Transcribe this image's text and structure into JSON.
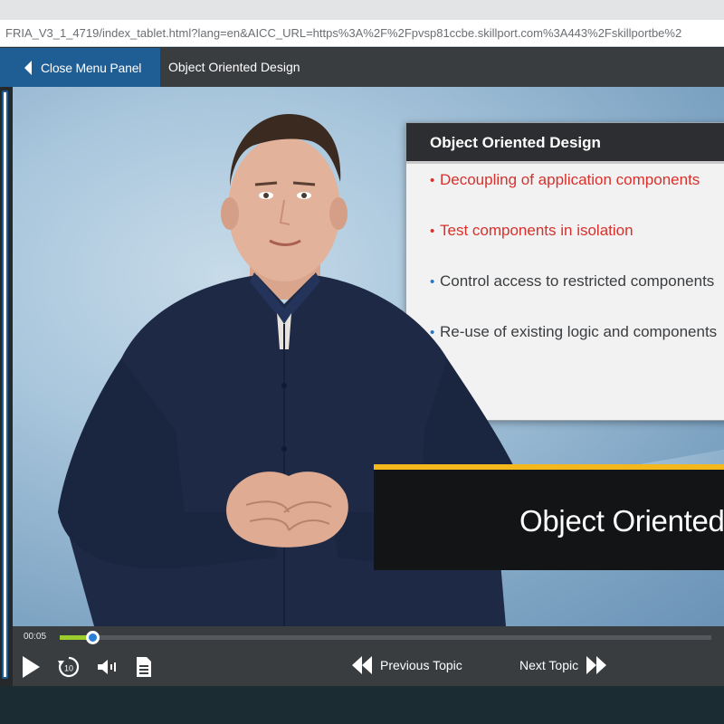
{
  "browser": {
    "url": "FRIA_V3_1_4719/index_tablet.html?lang=en&AICC_URL=https%3A%2F%2Fpvsp81ccbe.skillport.com%3A443%2Fskillportbe%2"
  },
  "header": {
    "close_menu_label": "Close Menu Panel",
    "course_title": "Object Oriented Design"
  },
  "slide": {
    "title": "Object Oriented Design",
    "bullets": [
      {
        "text": "Decoupling of application components",
        "style": "red"
      },
      {
        "text": "Test components in isolation",
        "style": "red"
      },
      {
        "text": "Control access to restricted components",
        "style": "dark"
      },
      {
        "text": "Re-use of existing logic and components",
        "style": "dark"
      }
    ]
  },
  "lower_third": {
    "text": "Object Oriented Design"
  },
  "controls": {
    "time": "00:05",
    "progress_fraction": 0.05,
    "prev_topic_label": "Previous Topic",
    "next_topic_label": "Next Topic"
  },
  "colors": {
    "header_bg": "#3a3d40",
    "menu_button_bg": "#1f5d95",
    "accent_yellow": "#f4b81d",
    "bullet_red": "#d8302b",
    "bullet_blue": "#2a76c0",
    "progress_green": "#9ccc2e"
  },
  "icons": [
    "chevron-left-icon",
    "play-icon",
    "replay-10-icon",
    "volume-icon",
    "transcript-icon",
    "previous-topic-icon",
    "next-topic-icon"
  ]
}
